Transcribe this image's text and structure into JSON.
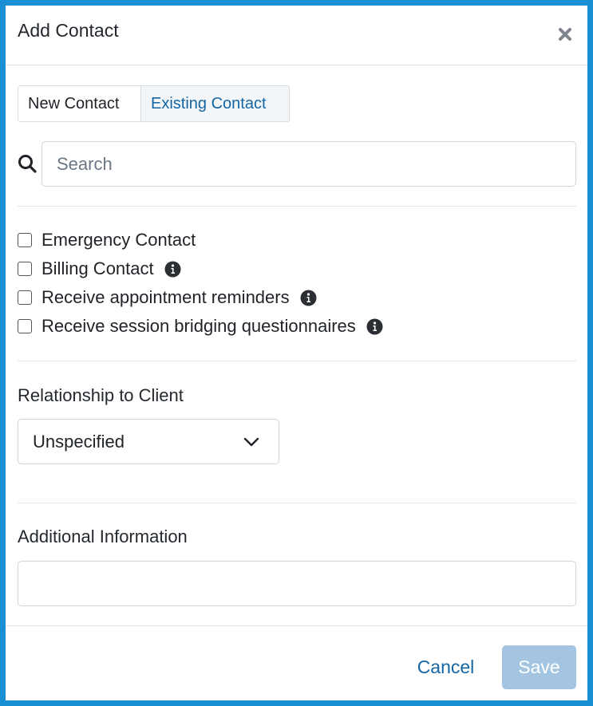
{
  "dialog": {
    "title": "Add Contact",
    "close_icon": "close-icon"
  },
  "tabs": [
    {
      "label": "New Contact",
      "active": false
    },
    {
      "label": "Existing Contact",
      "active": true
    }
  ],
  "search": {
    "placeholder": "Search",
    "value": "",
    "icon": "search-icon"
  },
  "options": [
    {
      "label": "Emergency Contact",
      "checked": false,
      "info": false
    },
    {
      "label": "Billing Contact",
      "checked": false,
      "info": true
    },
    {
      "label": "Receive appointment reminders",
      "checked": false,
      "info": true
    },
    {
      "label": "Receive session bridging questionnaires",
      "checked": false,
      "info": true
    }
  ],
  "relationship": {
    "label": "Relationship to Client",
    "selected": "Unspecified"
  },
  "additional": {
    "label": "Additional Information",
    "value": ""
  },
  "footer": {
    "cancel_label": "Cancel",
    "save_label": "Save"
  },
  "colors": {
    "frame": "#1a8fd6",
    "link": "#1565a3",
    "save_disabled": "#a4c5e2"
  }
}
